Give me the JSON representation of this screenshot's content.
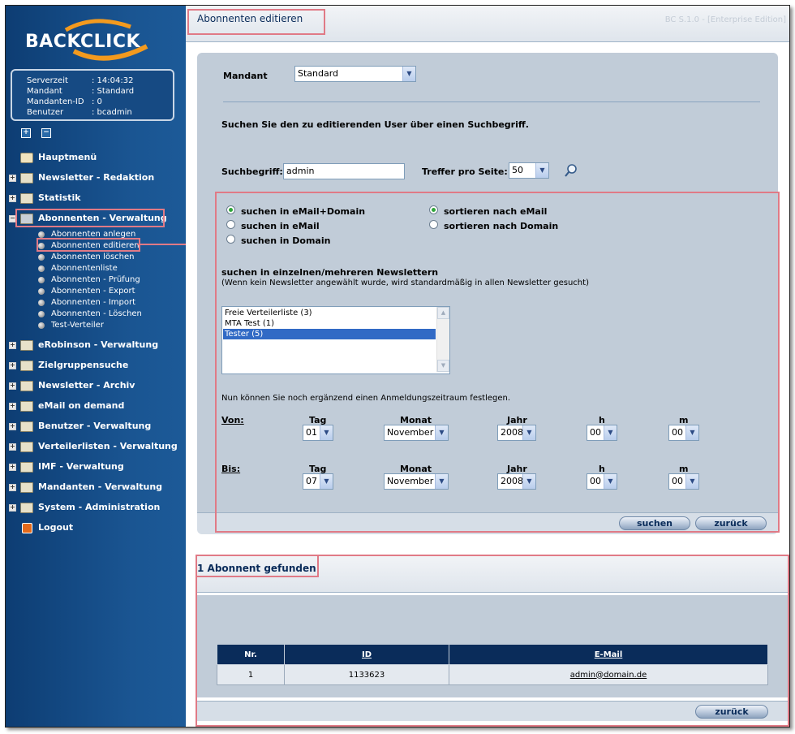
{
  "brand": {
    "logo": "BACKCLICK"
  },
  "info": [
    {
      "label": "Serverzeit",
      "value": ": 14:04:32"
    },
    {
      "label": "Mandant",
      "value": ": Standard"
    },
    {
      "label": "Mandanten-ID",
      "value": ": 0"
    },
    {
      "label": "Benutzer",
      "value": ": bcadmin"
    }
  ],
  "controls": {
    "expand": "+",
    "collapse": "−"
  },
  "nav": {
    "items": [
      {
        "label": "Hauptmenü",
        "icon": "home-icon"
      },
      {
        "label": "Newsletter - Redaktion",
        "icon": "folder-icon"
      },
      {
        "label": "Statistik",
        "icon": "folder-icon"
      },
      {
        "label": "Abonnenten - Verwaltung",
        "icon": "folder-open-icon"
      },
      {
        "label": "eRobinson - Verwaltung",
        "icon": "folder-icon"
      },
      {
        "label": "Zielgruppensuche",
        "icon": "folder-icon"
      },
      {
        "label": "Newsletter - Archiv",
        "icon": "folder-icon"
      },
      {
        "label": "eMail on demand",
        "icon": "folder-icon"
      },
      {
        "label": "Benutzer - Verwaltung",
        "icon": "folder-icon"
      },
      {
        "label": "Verteilerlisten - Verwaltung",
        "icon": "folder-icon"
      },
      {
        "label": "IMF - Verwaltung",
        "icon": "folder-icon"
      },
      {
        "label": "Mandanten - Verwaltung",
        "icon": "folder-icon"
      },
      {
        "label": "System - Administration",
        "icon": "folder-icon"
      },
      {
        "label": "Logout",
        "icon": "logout-icon"
      }
    ],
    "sub": [
      "Abonnenten anlegen",
      "Abonnenten editieren",
      "Abonnenten löschen",
      "Abonnentenliste",
      "Abonnenten - Prüfung",
      "Abonnenten - Export",
      "Abonnenten - Import",
      "Abonnenten - Löschen",
      "Test-Verteiler"
    ]
  },
  "header": {
    "title": "Abonnenten editieren",
    "version": "BC S.1.0 - [Enterprise Edition]"
  },
  "form": {
    "mandant_label": "Mandant",
    "mandant_value": "Standard",
    "instruction": "Suchen Sie den zu editierenden User über einen Suchbegriff.",
    "search_label": "Suchbegriff:",
    "search_value": "admin",
    "hits_label": "Treffer pro Seite:",
    "hits_value": "50",
    "search_opts": [
      {
        "label": "suchen in eMail+Domain",
        "checked": true
      },
      {
        "label": "suchen in eMail",
        "checked": false
      },
      {
        "label": "suchen in Domain",
        "checked": false
      }
    ],
    "sort_opts": [
      {
        "label": "sortieren nach eMail",
        "checked": true
      },
      {
        "label": "sortieren nach Domain",
        "checked": false
      }
    ],
    "newsletter_title": "suchen in einzelnen/mehreren Newslettern",
    "newsletter_note": "(Wenn kein Newsletter angewählt wurde, wird standardmäßig in allen Newsletter gesucht)",
    "newsletters": [
      "Freie Verteilerliste (3)",
      "MTA Test (1)",
      "Tester (5)"
    ],
    "newsletter_selected": 2,
    "period_note": "Nun können Sie noch ergänzend einen Anmeldungszeitraum festlegen.",
    "col_headers": {
      "day": "Tag",
      "month": "Monat",
      "year": "Jahr",
      "hour": "h",
      "minute": "m"
    },
    "from": {
      "label": "Von:",
      "day": "01",
      "month": "November",
      "year": "2008",
      "hour": "00",
      "minute": "00"
    },
    "to": {
      "label": "Bis:",
      "day": "07",
      "month": "November",
      "year": "2008",
      "hour": "00",
      "minute": "00"
    },
    "search_button": "suchen",
    "back_button": "zurück"
  },
  "results": {
    "title": "1 Abonnent gefunden",
    "columns": [
      "Nr.",
      "ID",
      "E-Mail"
    ],
    "rows": [
      [
        "1",
        "1133623",
        "admin@domain.de"
      ]
    ],
    "back_button": "zurück"
  },
  "colors": {
    "sidebar": "#1a5592",
    "navy": "#0a2c5a",
    "panel": "#c1ccd8",
    "highlight": "#e07a86"
  }
}
